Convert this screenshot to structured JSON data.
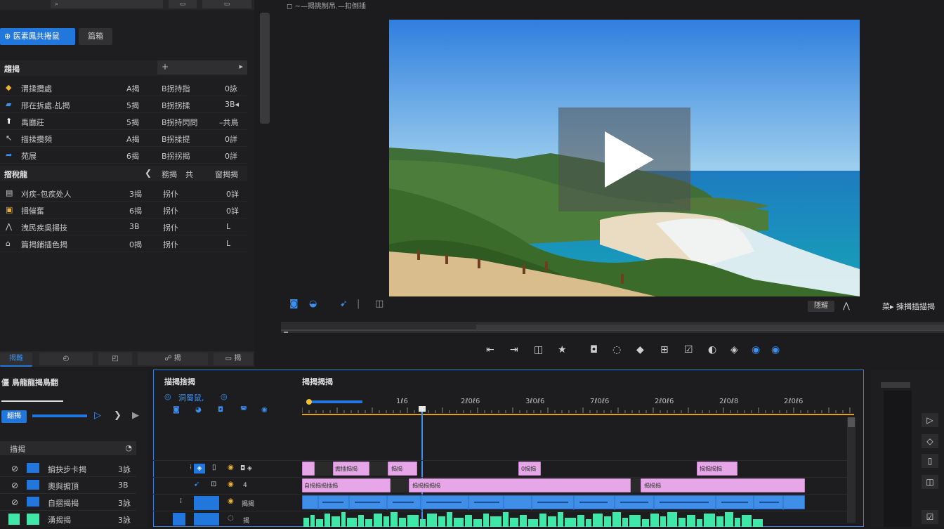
{
  "left_panel": {
    "top_buttons": [
      "⌕",
      "▭",
      "▭"
    ],
    "tabs": {
      "active": "⊕ 医素鳳共捲鼠",
      "inactive": "篇箱"
    },
    "section1_label": "趨揭",
    "search_icon": "+",
    "search_arrow": "▸",
    "rows1": [
      {
        "icon": "house-icon",
        "name": "渭揉攬處",
        "count": "A揭",
        "date": "B拐持指",
        "val": "0詠"
      },
      {
        "icon": "folder-icon",
        "name": "邢在拆處.乩揭",
        "count": "5揭",
        "date": "B拐拐揉",
        "val": "3B◂"
      },
      {
        "icon": "upload-icon",
        "name": "禹廳莊",
        "count": "5揭",
        "date": "B拐持閃問",
        "val": "–共鳥"
      },
      {
        "icon": "mic-icon",
        "name": "描揉攬頻",
        "count": "A揭",
        "date": "B拐揉提",
        "val": "0詳"
      },
      {
        "icon": "share-icon",
        "name": "苑展",
        "count": "6揭",
        "date": "B拐拐揭",
        "val": "0詳"
      }
    ],
    "section2_label": "摺稅龍",
    "section2_cols": [
      "❮",
      "務揭",
      "共",
      "窗揭揭"
    ],
    "rows2": [
      {
        "icon": "file-icon",
        "name": "刈疾–包疾处人",
        "count": "3揭",
        "date": "拐仆",
        "val": "0詳"
      },
      {
        "icon": "image-icon",
        "name": "揖催奮",
        "count": "6揭",
        "date": "拐仆",
        "val": "0詳"
      },
      {
        "icon": "chevron-icon",
        "name": "洩民疾吳揚技",
        "count": "3B",
        "date": "拐仆",
        "val": "L"
      },
      {
        "icon": "home-icon",
        "name": "篇揭鋪插色揭",
        "count": "0揭",
        "date": "拐仆",
        "val": "L"
      }
    ],
    "bottom_buttons": [
      "揭難",
      "◴",
      "◰",
      "☍ 揭",
      "▭ 揭"
    ]
  },
  "monitor": {
    "title": "◻ ~—揭挑制吊.—扣倒插",
    "controls": [
      "◙",
      "◒",
      "➹",
      "|",
      "◫"
    ],
    "zoom_label": "隱耀",
    "zoom_icon": "⋀",
    "right_label": "菜▸ 揀揖插描揭",
    "transport": [
      "⇤",
      "⇥",
      "◫",
      "★",
      "◘",
      "◌",
      "◆",
      "⊞",
      "☑",
      "◐",
      "◈",
      "◉",
      "◉"
    ]
  },
  "effects_panel": {
    "title": "僵 鳥龍龍揭鳥翻",
    "play_label": "翻揭",
    "toolbar": [
      "▷",
      "❯",
      "▶"
    ],
    "search_label": "描揭",
    "search_icon": "◔",
    "items": [
      {
        "name": "掮抉步卡揭",
        "val": "3詠"
      },
      {
        "name": "奧與掮頂",
        "val": "3B"
      },
      {
        "name": "自摺揭揭",
        "val": "3詠"
      },
      {
        "name": "湧揭揭",
        "val": "3詠"
      }
    ]
  },
  "timeline": {
    "title_left": "描揭捨揭",
    "title_right": "揭揭揭揭",
    "sub_label": "洞蜀鼠,",
    "ruler": [
      "1ℓ6",
      "2ℓ0ℓ6",
      "3ℓ0ℓ6",
      "7ℓ0ℓ6",
      "2ℓ0ℓ6",
      "2ℓ0ℓ8",
      "2ℓ0ℓ6"
    ],
    "clip_labels": {
      "p1": "掮插揭揭",
      "p2": "揭揭",
      "p3": "0揭揭",
      "p4": "揭揭揭揭",
      "a1": "自揭揭揭插揭",
      "a2": "揭揭揭揭揭",
      "a3": "揭揭揭"
    },
    "track_labels": [
      "◘ ◈",
      "4",
      "揭揭",
      "揭"
    ]
  },
  "right_tools": [
    "▷",
    "◇",
    "▯",
    "◫",
    "☑"
  ],
  "colors": {
    "accent": "#2277dd",
    "pink_clip": "#e6a6e8",
    "blue_clip": "#3f8fe8",
    "green_audio": "#3fe8a8"
  }
}
